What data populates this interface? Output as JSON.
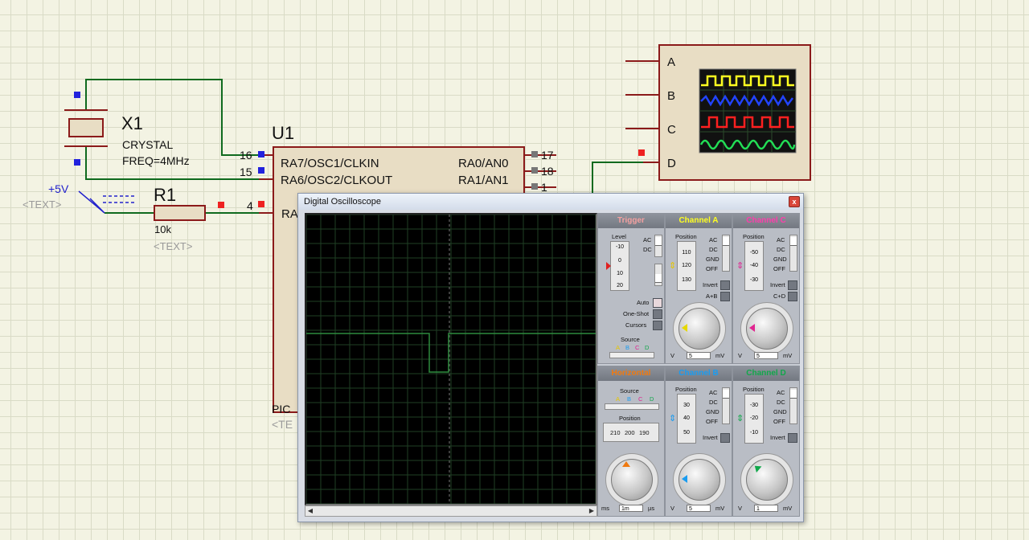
{
  "schematic": {
    "crystal": {
      "ref": "X1",
      "type": "CRYSTAL",
      "freq": "FREQ=4MHz"
    },
    "resistor": {
      "ref": "R1",
      "value": "10k",
      "text": "<TEXT>"
    },
    "power": {
      "label": "+5V",
      "text": "<TEXT>"
    },
    "mcu": {
      "ref": "U1",
      "pins_left": [
        {
          "num": "16",
          "name": "RA7/OSC1/CLKIN"
        },
        {
          "num": "15",
          "name": "RA6/OSC2/CLKOUT"
        },
        {
          "num": "4",
          "name": "RA"
        }
      ],
      "pins_right": [
        {
          "num": "17",
          "name": "RA0/AN0"
        },
        {
          "num": "18",
          "name": "RA1/AN1"
        },
        {
          "num": "1",
          "name": ""
        }
      ],
      "part_label": "PIC",
      "part_text": "<TE"
    },
    "scope_symbol": {
      "channels": [
        "A",
        "B",
        "C",
        "D"
      ]
    }
  },
  "oscilloscope": {
    "title": "Digital Oscilloscope",
    "close_label": "x",
    "trigger": {
      "header": "Trigger",
      "level_label": "Level",
      "level_ticks": [
        "-10",
        "0",
        "10",
        "20"
      ],
      "coupling": [
        "AC",
        "DC"
      ],
      "modes": [
        "Auto",
        "One-Shot",
        "Cursors"
      ],
      "source_label": "Source",
      "source_channels": [
        "A",
        "B",
        "C",
        "D"
      ]
    },
    "channels": [
      {
        "header": "Channel A",
        "color": "#ffff20",
        "position_label": "Position",
        "ticks": [
          "110",
          "120",
          "130"
        ],
        "coupling": [
          "AC",
          "DC",
          "GND",
          "OFF"
        ],
        "extra": [
          "Invert",
          "A+B"
        ],
        "volts": "5",
        "unit": "mV",
        "v_label": "V",
        "dial_marks": [
          "0.2",
          "0.1",
          "50",
          "20",
          "10",
          "5",
          "2",
          "1",
          "0.5",
          "20",
          "10",
          "5",
          "2",
          "20"
        ]
      },
      {
        "header": "Channel C",
        "color": "#ff3cac",
        "position_label": "Position",
        "ticks": [
          "-50",
          "-40",
          "-30"
        ],
        "coupling": [
          "AC",
          "DC",
          "GND",
          "OFF"
        ],
        "extra": [
          "Invert",
          "C+D"
        ],
        "volts": "5",
        "unit": "mV",
        "v_label": "V",
        "dial_marks": []
      },
      {
        "header": "Channel B",
        "color": "#1a9cf0",
        "position_label": "Position",
        "ticks": [
          "30",
          "40",
          "50"
        ],
        "coupling": [
          "AC",
          "DC",
          "GND",
          "OFF"
        ],
        "extra": [
          "Invert"
        ],
        "volts": "5",
        "unit": "mV",
        "v_label": "V",
        "dial_marks": []
      },
      {
        "header": "Channel D",
        "color": "#11a84a",
        "position_label": "Position",
        "ticks": [
          "-30",
          "-20",
          "-10"
        ],
        "coupling": [
          "AC",
          "DC",
          "GND",
          "OFF"
        ],
        "extra": [
          "Invert"
        ],
        "volts": "1",
        "unit": "mV",
        "v_label": "V",
        "dial_marks": []
      }
    ],
    "horizontal": {
      "header": "Horizontal",
      "header_color": "#f07a10",
      "source_label": "Source",
      "source_channels": [
        "A",
        "B",
        "C",
        "D"
      ],
      "position_label": "Position",
      "position_ticks": [
        "210",
        "200",
        "190"
      ],
      "timebase": "1m",
      "unit_left": "ms",
      "unit_right": "µs"
    }
  },
  "colors": {
    "wire": "#0f6a1e",
    "component": "#8b1a1a",
    "pin_marker_blue": "#2222dd",
    "pin_marker_red": "#ee2222",
    "trace": "#2e8b3e"
  }
}
